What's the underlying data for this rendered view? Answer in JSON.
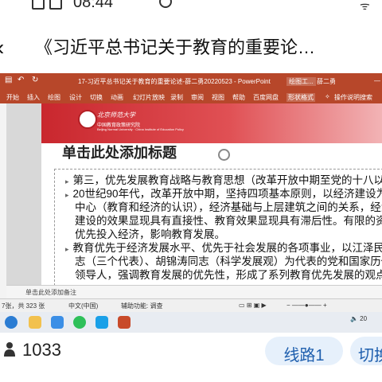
{
  "status_bar": {
    "time": "08:44"
  },
  "header": {
    "back_icon": "chevron-left-icon",
    "title": "《习近平总书记关于教育的重要论…"
  },
  "ppt": {
    "window_title": "17-习近平总书记关于教育的重要论述-薛二勇20220523  -  PowerPoint",
    "drawing_tools": "绘图工...",
    "user": "薛二勇",
    "ribbon_tabs": [
      "开始",
      "插入",
      "绘图",
      "设计",
      "切换",
      "动画",
      "幻灯片放映",
      "录制",
      "审阅",
      "视图",
      "帮助",
      "百度网盘",
      "形状格式"
    ],
    "ribbon_search": "操作说明搜索",
    "slide": {
      "institution_cn": "北京师范大学",
      "institution_sub": "中国教育政策研究院",
      "institution_en": "Beijing Normal University · China Institute of Education Policy",
      "title": "单击此处添加标题",
      "bullets": [
        {
          "lines": [
            "第三，优先发展教育战略与教育思想（改革开放中期至党的十八以前）"
          ]
        },
        {
          "lines": [
            "20世纪90年代，改革开放中期，坚持四项基本原则，以经济建设为",
            "中心（教育和经济的认识），经济基础与上层建筑之间的关系，经济",
            "建设的效果显现具有直接性、教育效果显现具有滞后性。有限的资源",
            "优先投入经济，影响教育发展。"
          ]
        },
        {
          "lines": [
            "教育优先于经济发展水平、优先于社会发展的各项事业，以江泽民同",
            "志（三个代表）、胡锦涛同志（科学发展观）为代表的党和国家历代",
            "领导人，强调教育发展的优先性，形成了系列教育优先发展的观点。"
          ]
        }
      ]
    },
    "notes_placeholder": "单击此处添加备注",
    "status": {
      "slide_count": "7张，共 323 张",
      "language": "中文(中国)",
      "accessibility": "辅助功能: 调查"
    }
  },
  "bottom": {
    "viewers": "1033",
    "line_button": "线路1",
    "switch_button": "切换"
  },
  "colors": {
    "ppt_brand": "#b7472a",
    "accent_blue": "#1f5fae",
    "slide_red": "#c9272e"
  }
}
